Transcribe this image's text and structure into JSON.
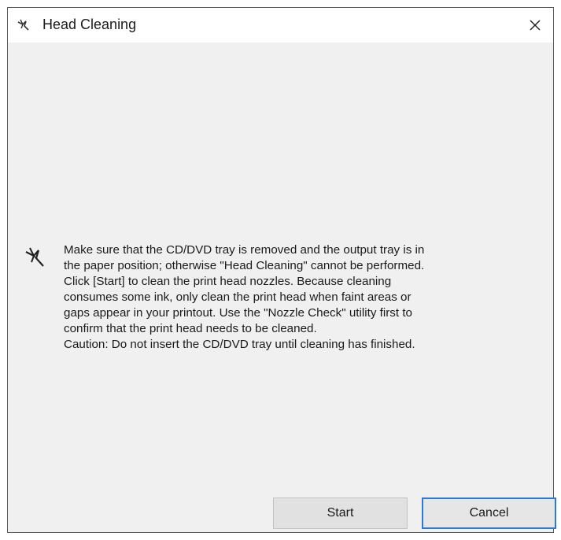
{
  "window": {
    "title": "Head Cleaning",
    "title_icon": "pen-nib-icon",
    "close_glyph": "✕"
  },
  "message": {
    "icon": "pen-nib-icon",
    "lines": [
      "Make sure that the CD/DVD tray is removed and the output tray is in",
      "the paper position; otherwise \"Head Cleaning\" cannot be performed.",
      "Click [Start] to clean the print head nozzles. Because cleaning",
      "consumes some ink, only clean the print head when faint areas or",
      "gaps appear in your printout. Use the \"Nozzle Check\" utility first to",
      "confirm that the print head needs to be cleaned.",
      "Caution: Do not insert the CD/DVD tray until cleaning has finished."
    ]
  },
  "buttons": {
    "start_label": "Start",
    "cancel_label": "Cancel"
  },
  "colors": {
    "focus_border": "#2b7bd6",
    "dialog_background": "#f0f0f0"
  }
}
